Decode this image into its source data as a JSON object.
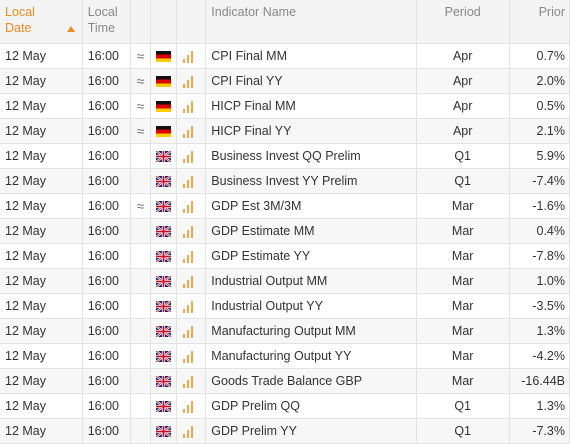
{
  "header": {
    "date_label": "Local Date",
    "time_label": "Local Time",
    "name_label": "Indicator Name",
    "period_label": "Period",
    "prior_label": "Prior"
  },
  "rows": [
    {
      "date": "12 May",
      "time": "16:00",
      "revised": "≈",
      "flag": "de",
      "name": "CPI Final MM",
      "period": "Apr",
      "prior": "0.7%"
    },
    {
      "date": "12 May",
      "time": "16:00",
      "revised": "≈",
      "flag": "de",
      "name": "CPI Final YY",
      "period": "Apr",
      "prior": "2.0%"
    },
    {
      "date": "12 May",
      "time": "16:00",
      "revised": "≈",
      "flag": "de",
      "name": "HICP Final MM",
      "period": "Apr",
      "prior": "0.5%"
    },
    {
      "date": "12 May",
      "time": "16:00",
      "revised": "≈",
      "flag": "de",
      "name": "HICP Final YY",
      "period": "Apr",
      "prior": "2.1%"
    },
    {
      "date": "12 May",
      "time": "16:00",
      "revised": "",
      "flag": "gb",
      "name": "Business Invest QQ Prelim",
      "period": "Q1",
      "prior": "5.9%"
    },
    {
      "date": "12 May",
      "time": "16:00",
      "revised": "",
      "flag": "gb",
      "name": "Business Invest YY Prelim",
      "period": "Q1",
      "prior": "-7.4%"
    },
    {
      "date": "12 May",
      "time": "16:00",
      "revised": "≈",
      "flag": "gb",
      "name": "GDP Est 3M/3M",
      "period": "Mar",
      "prior": "-1.6%"
    },
    {
      "date": "12 May",
      "time": "16:00",
      "revised": "",
      "flag": "gb",
      "name": "GDP Estimate MM",
      "period": "Mar",
      "prior": "0.4%"
    },
    {
      "date": "12 May",
      "time": "16:00",
      "revised": "",
      "flag": "gb",
      "name": "GDP Estimate YY",
      "period": "Mar",
      "prior": "-7.8%"
    },
    {
      "date": "12 May",
      "time": "16:00",
      "revised": "",
      "flag": "gb",
      "name": "Industrial Output MM",
      "period": "Mar",
      "prior": "1.0%"
    },
    {
      "date": "12 May",
      "time": "16:00",
      "revised": "",
      "flag": "gb",
      "name": "Industrial Output YY",
      "period": "Mar",
      "prior": "-3.5%"
    },
    {
      "date": "12 May",
      "time": "16:00",
      "revised": "",
      "flag": "gb",
      "name": "Manufacturing Output MM",
      "period": "Mar",
      "prior": "1.3%"
    },
    {
      "date": "12 May",
      "time": "16:00",
      "revised": "",
      "flag": "gb",
      "name": "Manufacturing Output YY",
      "period": "Mar",
      "prior": "-4.2%"
    },
    {
      "date": "12 May",
      "time": "16:00",
      "revised": "",
      "flag": "gb",
      "name": "Goods Trade Balance GBP",
      "period": "Mar",
      "prior": "-16.44B"
    },
    {
      "date": "12 May",
      "time": "16:00",
      "revised": "",
      "flag": "gb",
      "name": "GDP Prelim QQ",
      "period": "Q1",
      "prior": "1.3%"
    },
    {
      "date": "12 May",
      "time": "16:00",
      "revised": "",
      "flag": "gb",
      "name": "GDP Prelim YY",
      "period": "Q1",
      "prior": "-7.3%"
    }
  ],
  "colors": {
    "accent": "#f28a1e",
    "impact_bar": "#f5a54a"
  },
  "icons": {
    "revised": "approx-icon",
    "importance": "importance-bars-icon",
    "de": "germany-flag-icon",
    "gb": "uk-flag-icon"
  }
}
